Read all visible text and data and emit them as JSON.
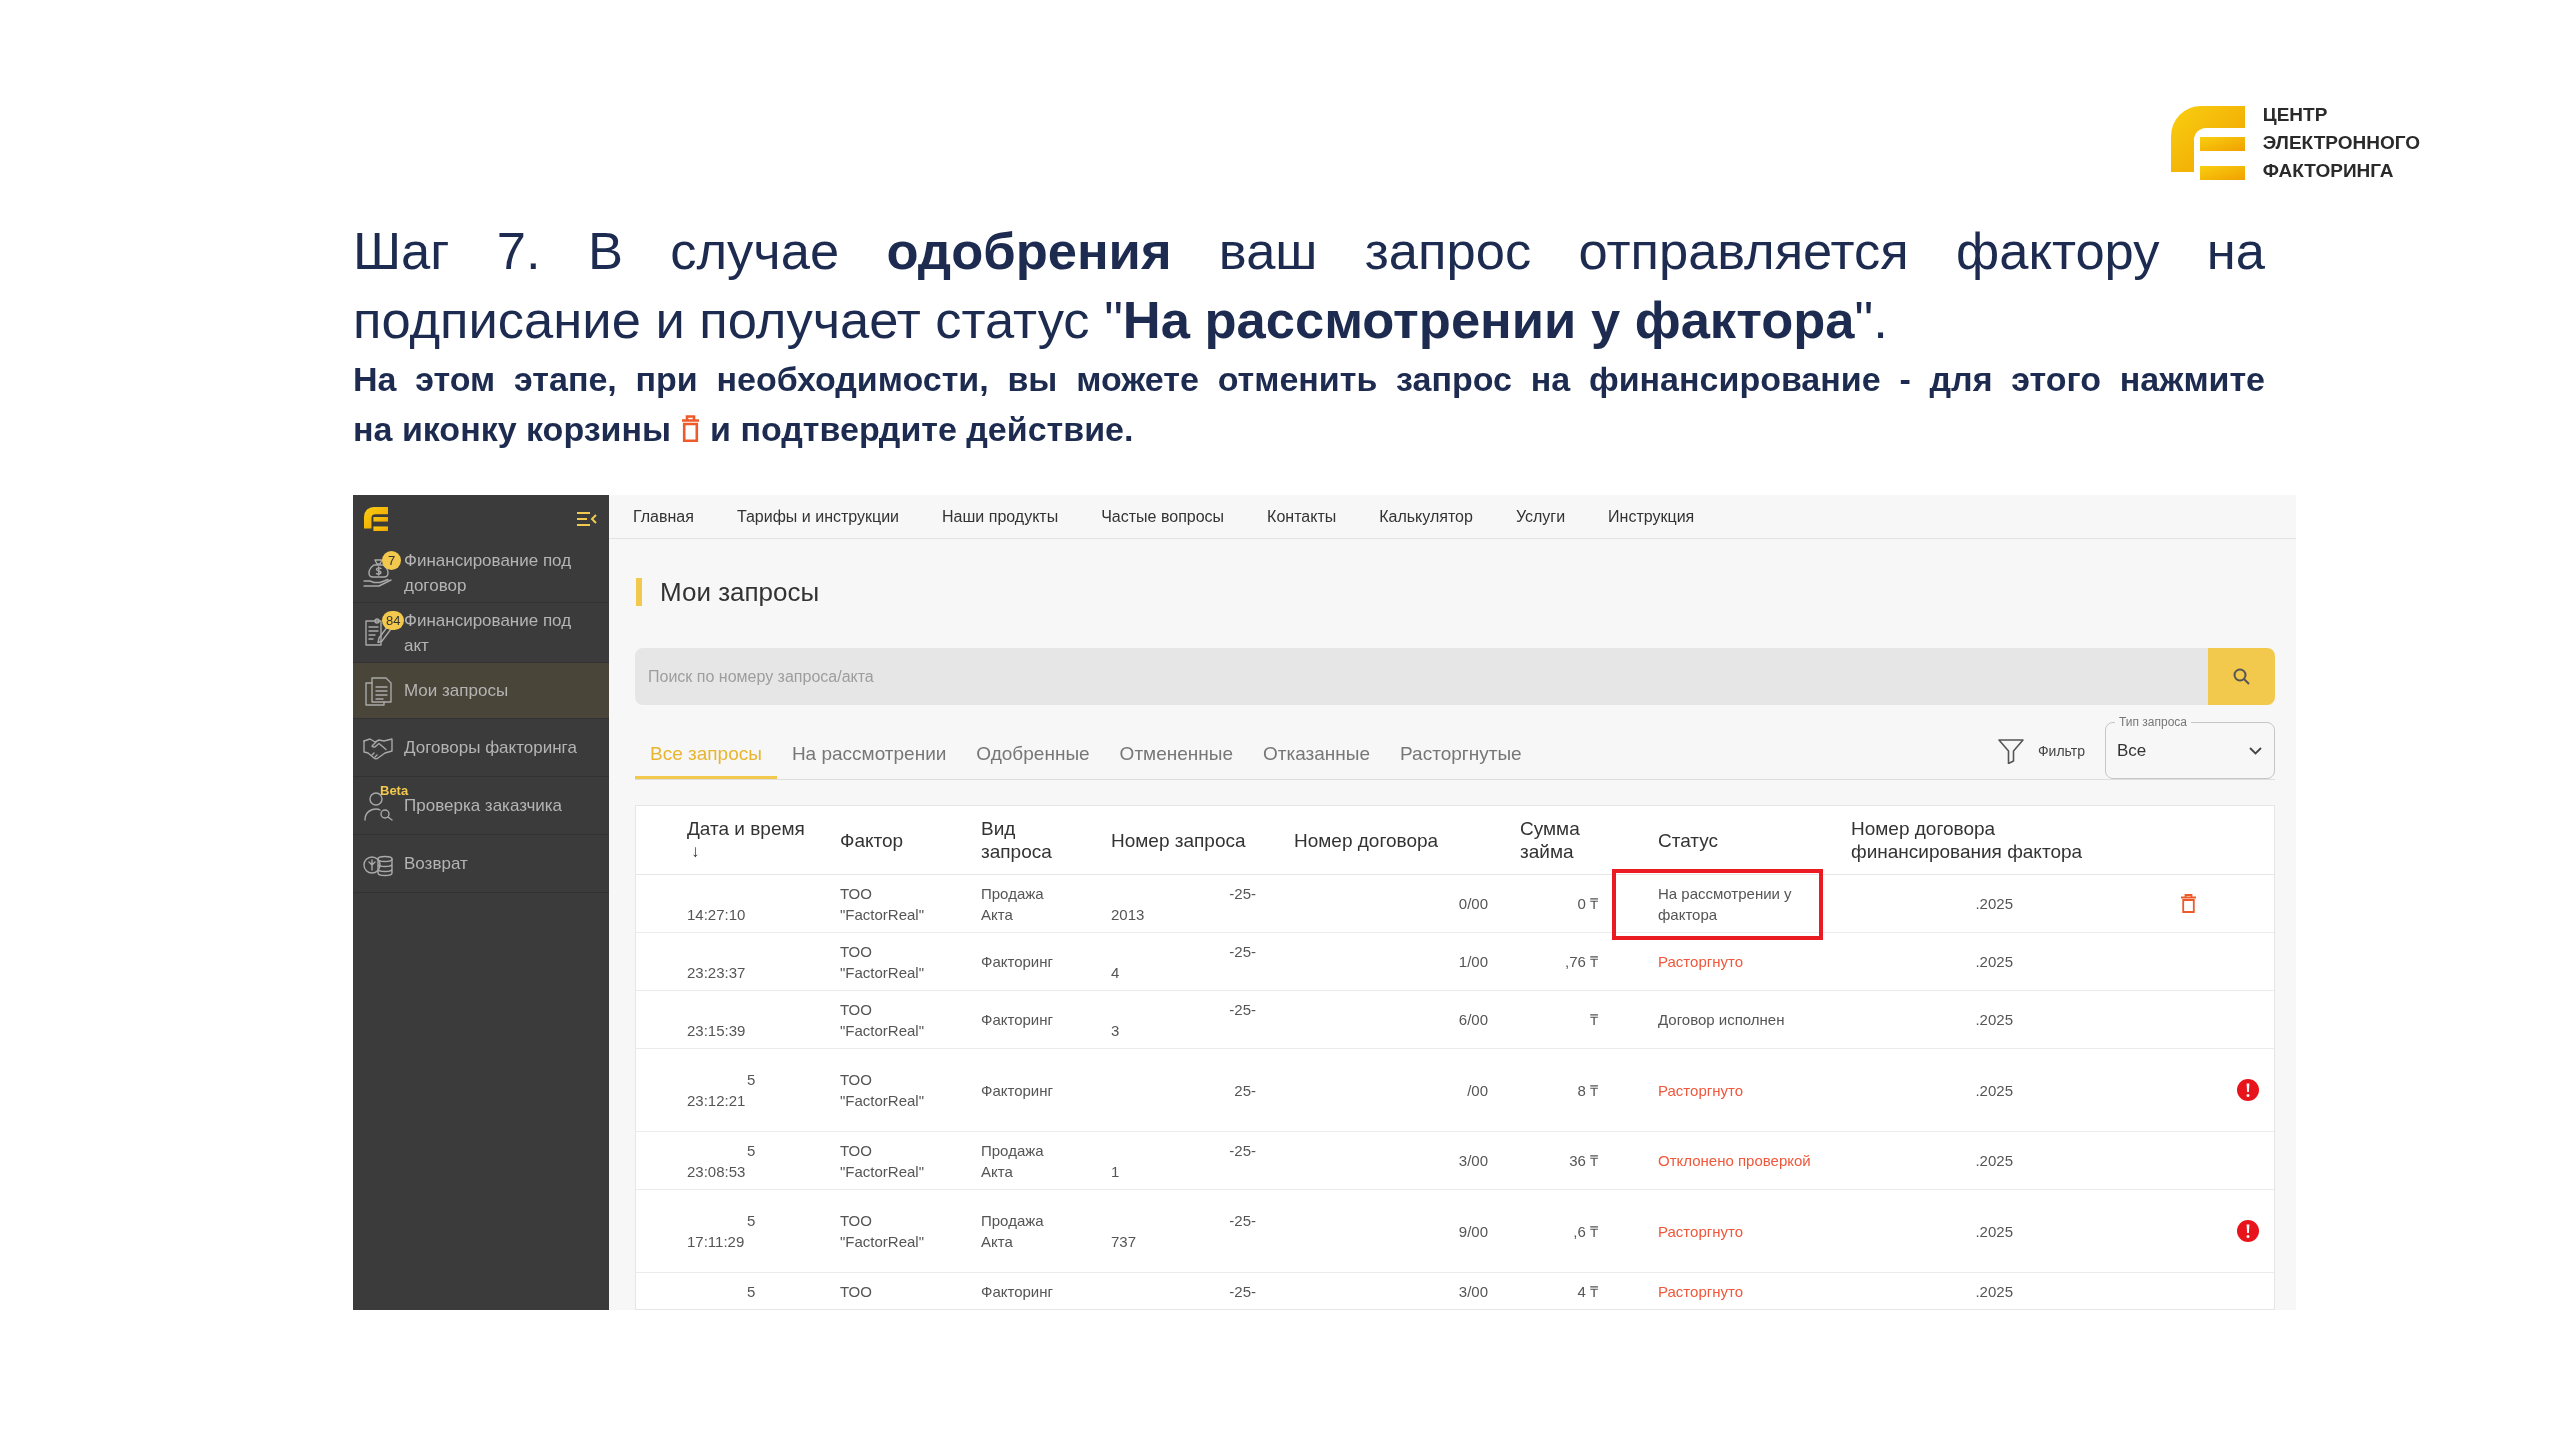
{
  "logo": {
    "lines": [
      "ЦЕНТР",
      "ЭЛЕКТРОННОГО",
      "ФАКТОРИНГА"
    ]
  },
  "heading": "Шаг 7. В случае **одобрения** ваш запрос отправляется фактору на подписание и получает статус \"**На рассмотрении у фактора**\".",
  "instruction": {
    "first_line": "На этом этапе, при необходимости, вы можете отменить запрос на финансирование - для этого нажмите",
    "before_icon": "на иконку корзины",
    "after_icon": "и подтвердите действие."
  },
  "screenshot": {
    "sidebar": {
      "items": [
        {
          "label": "Финансирование под договор",
          "badge": "7",
          "selected": false
        },
        {
          "label": "Финансирование под акт",
          "badge": "84",
          "selected": false
        },
        {
          "label": "Мои запросы",
          "selected": true
        },
        {
          "label": "Договоры факторинга",
          "selected": false
        },
        {
          "label": "Проверка заказчика",
          "tag": "Beta",
          "selected": false
        },
        {
          "label": "Возврат",
          "selected": false
        }
      ]
    },
    "nav": [
      "Главная",
      "Тарифы и инструкции",
      "Наши продукты",
      "Частые вопросы",
      "Контакты",
      "Калькулятор",
      "Услуги",
      "Инструкция"
    ],
    "page_title": "Мои запросы",
    "search": {
      "placeholder": "Поиск по номеру запроса/акта"
    },
    "tabs": [
      {
        "label": "Все запросы",
        "selected": true
      },
      {
        "label": "На рассмотрении",
        "selected": false
      },
      {
        "label": "Одобренные",
        "selected": false
      },
      {
        "label": "Отмененные",
        "selected": false
      },
      {
        "label": "Отказанные",
        "selected": false
      },
      {
        "label": "Расторгнутые",
        "selected": false
      }
    ],
    "filter": {
      "label": "Фильтр"
    },
    "type_select": {
      "label": "Тип запроса",
      "value": "Все"
    },
    "table": {
      "columns": [
        {
          "label": "Дата и время",
          "sort_mark": "↓"
        },
        {
          "label": "Фактор"
        },
        {
          "label": "Вид запроса"
        },
        {
          "label": "Номер запроса"
        },
        {
          "label": "Номер договора"
        },
        {
          "label": "Сумма займа"
        },
        {
          "label": "Статус"
        },
        {
          "label": "Номер договора финансирования фактора"
        }
      ],
      "rows": [
        {
          "time": "14:27:10",
          "factor": "ТОО \"FactorReal\"",
          "type": "Продажа Акта",
          "number": [
            "-25-",
            "2013"
          ],
          "contract": "0/00",
          "amount": "0 ₸",
          "status": "На рассмотрении у фактора",
          "status_negative": false,
          "fin_contract": ".2025",
          "deletable": true,
          "warning": false,
          "highlighted": true
        },
        {
          "time": "23:23:37",
          "factor": "ТОО \"FactorReal\"",
          "type": "Факторинг",
          "number": [
            "-25-",
            "4"
          ],
          "contract": "1/00",
          "amount": ",76 ₸",
          "status": "Расторгнуто",
          "status_negative": true,
          "fin_contract": ".2025",
          "deletable": false,
          "warning": false,
          "highlighted": false
        },
        {
          "time": "23:15:39",
          "factor": "ТОО \"FactorReal\"",
          "type": "Факторинг",
          "number": [
            "-25-",
            "3"
          ],
          "contract": "6/00",
          "amount": "₸",
          "status": "Договор исполнен",
          "status_negative": false,
          "fin_contract": ".2025",
          "deletable": false,
          "warning": false,
          "highlighted": false
        },
        {
          "date": "5",
          "time": "23:12:21",
          "factor": "ТОО \"FactorReal\"",
          "type": "Факторинг",
          "number": [
            "25-"
          ],
          "contract": "/00",
          "amount": "8 ₸",
          "status": "Расторгнуто",
          "status_negative": true,
          "fin_contract": ".2025",
          "deletable": false,
          "warning": true,
          "highlighted": false
        },
        {
          "date": "5",
          "time": "23:08:53",
          "factor": "ТОО \"FactorReal\"",
          "type": "Продажа Акта",
          "number": [
            "-25-",
            "1"
          ],
          "contract": "3/00",
          "amount": "36 ₸",
          "status": "Отклонено проверкой",
          "status_negative": true,
          "fin_contract": ".2025",
          "deletable": false,
          "warning": false,
          "highlighted": false
        },
        {
          "date": "5",
          "time": "17:11:29",
          "factor": "ТОО \"FactorReal\"",
          "type": "Продажа Акта",
          "number": [
            "-25-",
            "737"
          ],
          "contract": "9/00",
          "amount": ",6 ₸",
          "status": "Расторгнуто",
          "status_negative": true,
          "fin_contract": ".2025",
          "deletable": false,
          "warning": true,
          "highlighted": false
        },
        {
          "date": "5",
          "factor": "ТОО",
          "type": "Факторинг",
          "number": [
            "-25-"
          ],
          "contract": "3/00",
          "amount": "4 ₸",
          "status": "Расторгнуто",
          "status_negative": true,
          "fin_contract": ".2025",
          "deletable": false,
          "warning": false,
          "highlighted": false
        }
      ]
    }
  }
}
